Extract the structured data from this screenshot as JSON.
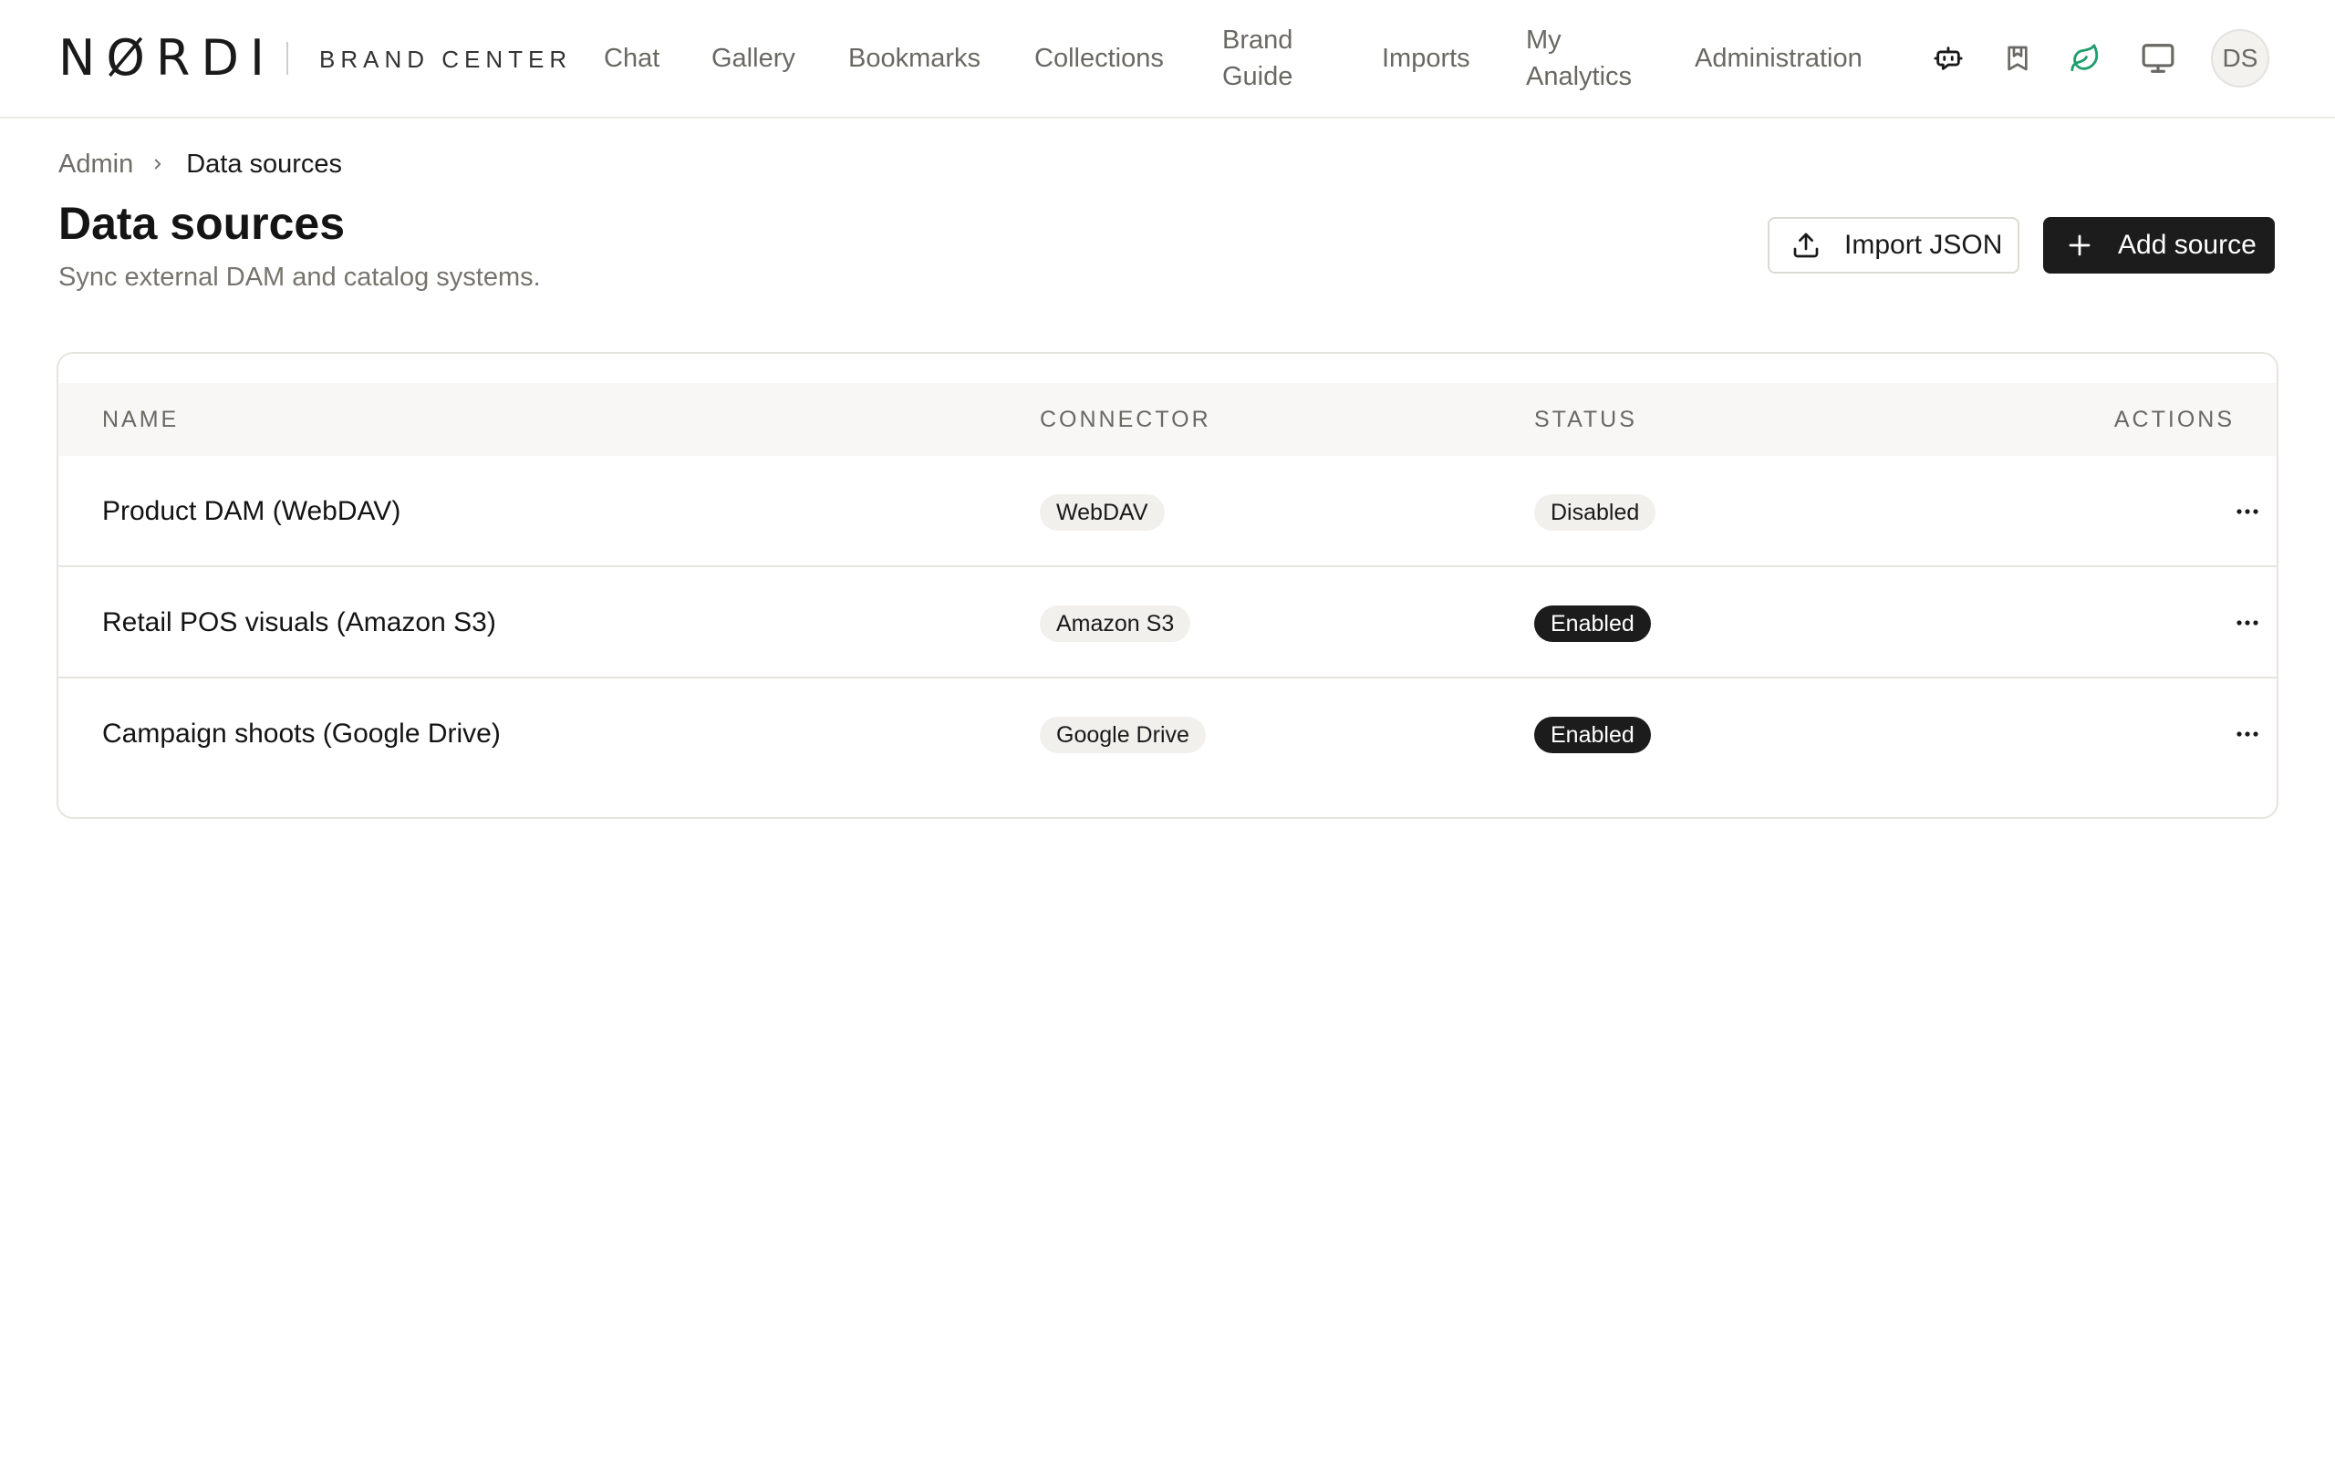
{
  "brand": {
    "logo": "NØRDI",
    "subtitle": "BRAND CENTER"
  },
  "nav": {
    "chat": "Chat",
    "gallery": "Gallery",
    "bookmarks": "Bookmarks",
    "collections": "Collections",
    "brand_guide": "Brand Guide",
    "imports": "Imports",
    "my_analytics": "My Analytics",
    "administration": "Administration"
  },
  "header_icons": [
    "bot-icon",
    "bookmark-icon",
    "leaf-icon",
    "monitor-icon"
  ],
  "accent_color": "#1f9d6b",
  "user": {
    "initials": "DS"
  },
  "breadcrumb": {
    "root": "Admin",
    "current": "Data sources"
  },
  "page": {
    "title": "Data sources",
    "subtitle": "Sync external DAM and catalog systems."
  },
  "actions": {
    "import_label": "Import JSON",
    "add_label": "Add source"
  },
  "table": {
    "columns": {
      "name": "NAME",
      "connector": "CONNECTOR",
      "status": "STATUS",
      "actions": "ACTIONS"
    },
    "rows": [
      {
        "name": "Product DAM (WebDAV)",
        "connector": "WebDAV",
        "status": "Disabled"
      },
      {
        "name": "Retail POS visuals (Amazon S3)",
        "connector": "Amazon S3",
        "status": "Enabled"
      },
      {
        "name": "Campaign shoots (Google Drive)",
        "connector": "Google Drive",
        "status": "Enabled"
      }
    ]
  }
}
